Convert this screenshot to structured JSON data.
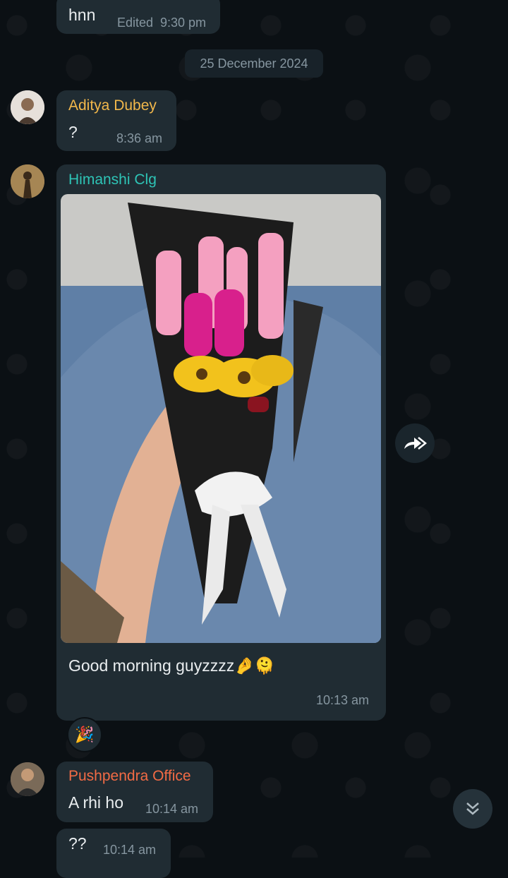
{
  "messages": [
    {
      "text": "hnn",
      "edited_label": "Edited",
      "time": "9:30 pm"
    },
    {
      "date_divider": "25 December 2024"
    },
    {
      "sender": "Aditya Dubey",
      "sender_color": "#f2b84b",
      "text": "?",
      "time": "8:36 am"
    },
    {
      "sender": "Himanshi Clg",
      "sender_color": "#2ec4b6",
      "caption": "Good morning guyzzzz🤌🫠",
      "time": "10:13 am",
      "reaction": "🎉"
    },
    {
      "sender": "Pushpendra Office",
      "sender_color": "#f26b45",
      "text": "A rhi ho",
      "time": "10:14 am"
    },
    {
      "text": "??",
      "time": "10:14 am"
    }
  ],
  "icons": {
    "forward": "forward-icon",
    "scroll_down": "double-chevron-down-icon"
  }
}
